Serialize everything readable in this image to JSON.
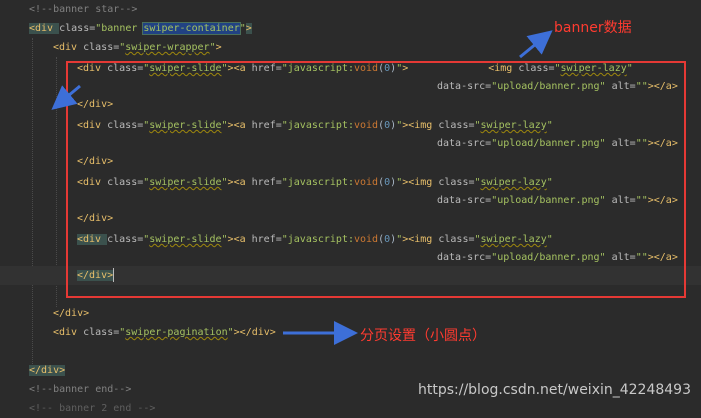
{
  "code": {
    "line1": "<!--banner star-->",
    "line2": {
      "open": "<div ",
      "class_attr": "class=",
      "class_q1": "\"banner ",
      "class_swiper": "swiper-container",
      "class_q2": "\"",
      "close": ">"
    },
    "line3": {
      "open": "<div ",
      "class_attr": "class=",
      "q1": "\"",
      "cls": "swiper-wrapper",
      "q2": "\"",
      "close": ">"
    },
    "slide_open": "<div ",
    "slide_class_attr": "class=",
    "slide_q1": "\"",
    "slide_cls": "swiper-slide",
    "slide_q2": "\"",
    "slide_close": ">",
    "a_open": "<a ",
    "href_attr": "href=",
    "href_q1": "\"javascript:",
    "href_void": "void",
    "href_paren1": "(",
    "href_zero": "0",
    "href_paren2": ")",
    "href_q2": "\"",
    "a_close": ">",
    "img_open": "<img ",
    "img_class_attr": "class=",
    "img_q1": "\"",
    "img_cls": "swiper-lazy",
    "img_q2": "\"",
    "datasrc_attr": "data-src=",
    "datasrc_val": "\"upload/banner.png\"",
    "alt_attr": " alt=",
    "alt_val": "\"\"",
    "img_end": ">",
    "a_end": "</a>",
    "div_end": "</div>",
    "pagination": {
      "open": "<div ",
      "class_attr": "class=",
      "q1": "\"",
      "cls": "swiper-pagination",
      "q2": "\"",
      "close": "></div>"
    },
    "comment_end": "<!--banner end-->",
    "last_partial": "<!-- banner 2 end -->"
  },
  "annotations": {
    "banner_note": "banner数据",
    "pagination_note": "分页设置（小圆点）"
  },
  "watermark": "https://blog.csdn.net/weixin_42248493",
  "colors": {
    "background": "#2b2b2b",
    "tag": "#e8bf6a",
    "string": "#a5c261",
    "keyword": "#cc7832",
    "callout": "#e53935",
    "arrow": "#3d6fd8"
  }
}
